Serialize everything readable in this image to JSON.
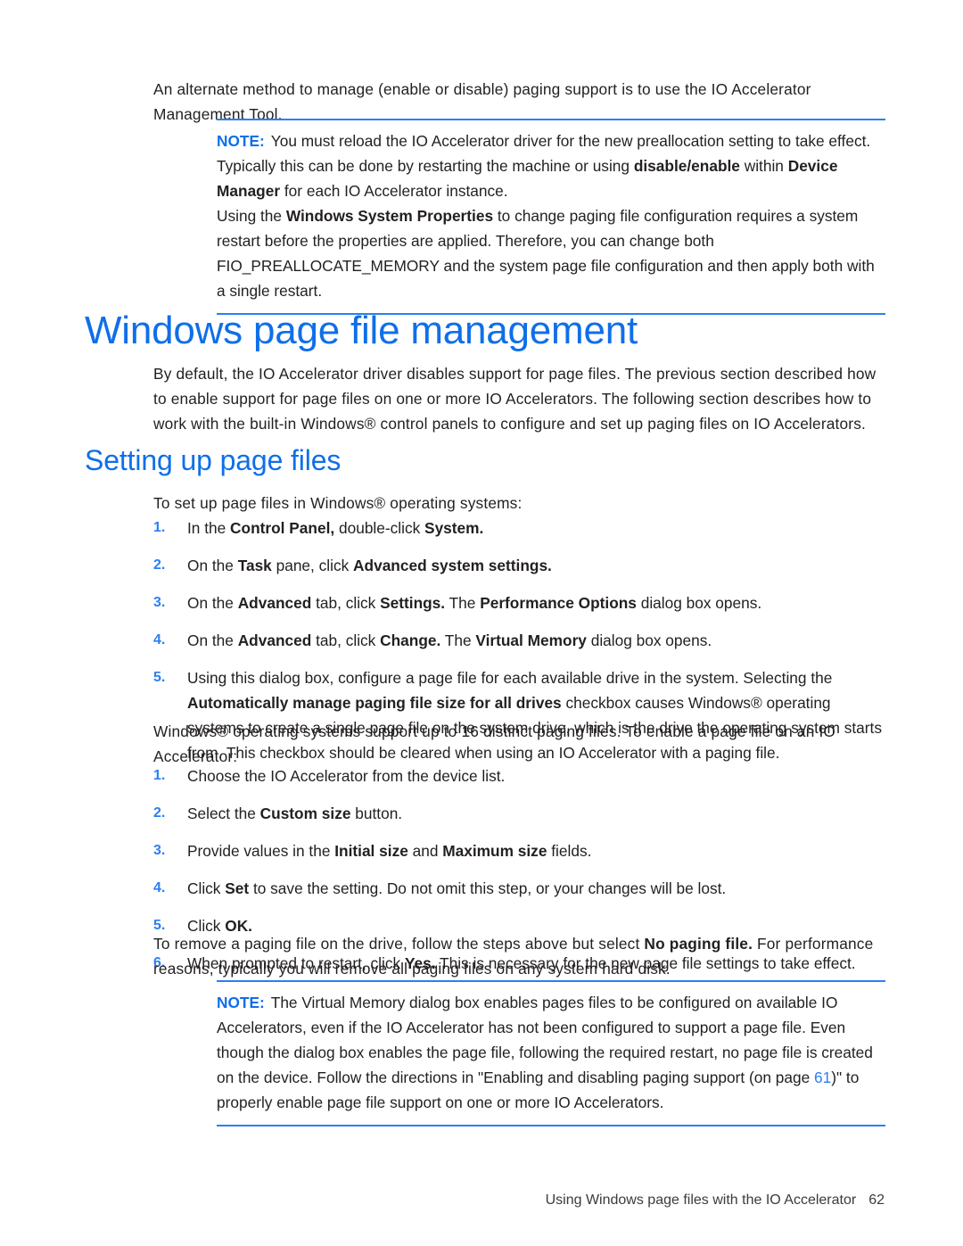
{
  "document": {
    "intro_paragraph": "An alternate method to manage (enable or disable) paging support is to use the IO Accelerator Management Tool.",
    "note_top": {
      "label": "NOTE:",
      "para1_a": "You must reload the IO Accelerator driver for the new preallocation setting to take effect. Typically this can be done by restarting the machine or using ",
      "para1_b": "disable/enable",
      "para1_c": " within ",
      "para1_d": "Device Manager",
      "para1_e": " for each IO Accelerator instance.",
      "para2_a": "Using the ",
      "para2_b": "Windows System Properties",
      "para2_c": " to change paging file configuration requires a system restart before the properties are applied. Therefore, you can change both FIO_PREALLOCATE_MEMORY and the system page file configuration and then apply both with a single restart."
    },
    "heading1": "Windows page file management",
    "section_intro": "By default, the IO Accelerator driver disables support for page files. The previous section described how to enable support for page files on one or more IO Accelerators. The following section describes how to work with the built-in Windows® control panels to configure and set up paging files on IO Accelerators.",
    "heading2": "Setting up page files",
    "list1_intro": "To set up page files in Windows® operating systems:",
    "list1": [
      {
        "num": "1.",
        "parts": [
          {
            "t": "In the ",
            "b": false
          },
          {
            "t": "Control Panel,",
            "b": true
          },
          {
            "t": " double-click ",
            "b": false
          },
          {
            "t": "System.",
            "b": true
          }
        ]
      },
      {
        "num": "2.",
        "parts": [
          {
            "t": "On the ",
            "b": false
          },
          {
            "t": "Task",
            "b": true
          },
          {
            "t": " pane, click ",
            "b": false
          },
          {
            "t": "Advanced system settings.",
            "b": true
          }
        ]
      },
      {
        "num": "3.",
        "parts": [
          {
            "t": "On the ",
            "b": false
          },
          {
            "t": "Advanced",
            "b": true
          },
          {
            "t": " tab, click ",
            "b": false
          },
          {
            "t": "Settings.",
            "b": true
          },
          {
            "t": " The ",
            "b": false
          },
          {
            "t": "Performance Options",
            "b": true
          },
          {
            "t": " dialog box opens.",
            "b": false
          }
        ]
      },
      {
        "num": "4.",
        "parts": [
          {
            "t": "On the ",
            "b": false
          },
          {
            "t": "Advanced",
            "b": true
          },
          {
            "t": " tab, click ",
            "b": false
          },
          {
            "t": "Change.",
            "b": true
          },
          {
            "t": " The ",
            "b": false
          },
          {
            "t": "Virtual Memory",
            "b": true
          },
          {
            "t": " dialog box opens.",
            "b": false
          }
        ]
      },
      {
        "num": "5.",
        "parts": [
          {
            "t": "Using this dialog box, configure a page file for each available drive in the system. Selecting the ",
            "b": false
          },
          {
            "t": "Automatically manage paging file size for all drives",
            "b": true
          },
          {
            "t": " checkbox causes Windows® operating systems to create a single page file on the system drive, which is the drive the operating system starts from. This checkbox should be cleared when using an IO Accelerator with a paging file.",
            "b": false
          }
        ]
      }
    ],
    "list2_intro": "Windows® operating systems support up to 16 distinct paging files. To enable a page file on an IO Accelerator:",
    "list2": [
      {
        "num": "1.",
        "parts": [
          {
            "t": "Choose the IO Accelerator from the device list.",
            "b": false
          }
        ]
      },
      {
        "num": "2.",
        "parts": [
          {
            "t": "Select the ",
            "b": false
          },
          {
            "t": "Custom size",
            "b": true
          },
          {
            "t": " button.",
            "b": false
          }
        ]
      },
      {
        "num": "3.",
        "parts": [
          {
            "t": "Provide values in the ",
            "b": false
          },
          {
            "t": "Initial size",
            "b": true
          },
          {
            "t": " and ",
            "b": false
          },
          {
            "t": "Maximum size",
            "b": true
          },
          {
            "t": " fields.",
            "b": false
          }
        ]
      },
      {
        "num": "4.",
        "parts": [
          {
            "t": "Click ",
            "b": false
          },
          {
            "t": "Set",
            "b": true
          },
          {
            "t": " to save the setting. Do not omit this step, or your changes will be lost.",
            "b": false
          }
        ]
      },
      {
        "num": "5.",
        "parts": [
          {
            "t": "Click ",
            "b": false
          },
          {
            "t": "OK.",
            "b": true
          }
        ]
      },
      {
        "num": "6.",
        "parts": [
          {
            "t": "When prompted to restart, click ",
            "b": false
          },
          {
            "t": "Yes.",
            "b": true
          },
          {
            "t": " This is necessary for the new page file settings to take effect.",
            "b": false
          }
        ]
      }
    ],
    "closing_paragraph": {
      "a": "To remove a paging file on the drive, follow the steps above but select ",
      "b": "No paging file.",
      "c": " For performance reasons, typically you will remove all paging files on any system hard disk."
    },
    "note_bottom": {
      "label": "NOTE:",
      "a": "The Virtual Memory dialog box enables pages files to be configured on available IO Accelerators, even if the IO Accelerator has not been configured to support a page file. Even though the dialog box enables the page file, following the required restart, no page file is created on the device. Follow the directions in \"Enabling and disabling paging support (on page ",
      "xref": "61",
      "b": ")\" to properly enable page file support on one or more IO Accelerators."
    },
    "footer": {
      "running_title": "Using Windows page files with the IO Accelerator",
      "page_number": "62"
    },
    "colors": {
      "heading_blue": "#0f6fe8",
      "rule_blue": "#2d7ff0",
      "body_text": "#231f20"
    }
  }
}
